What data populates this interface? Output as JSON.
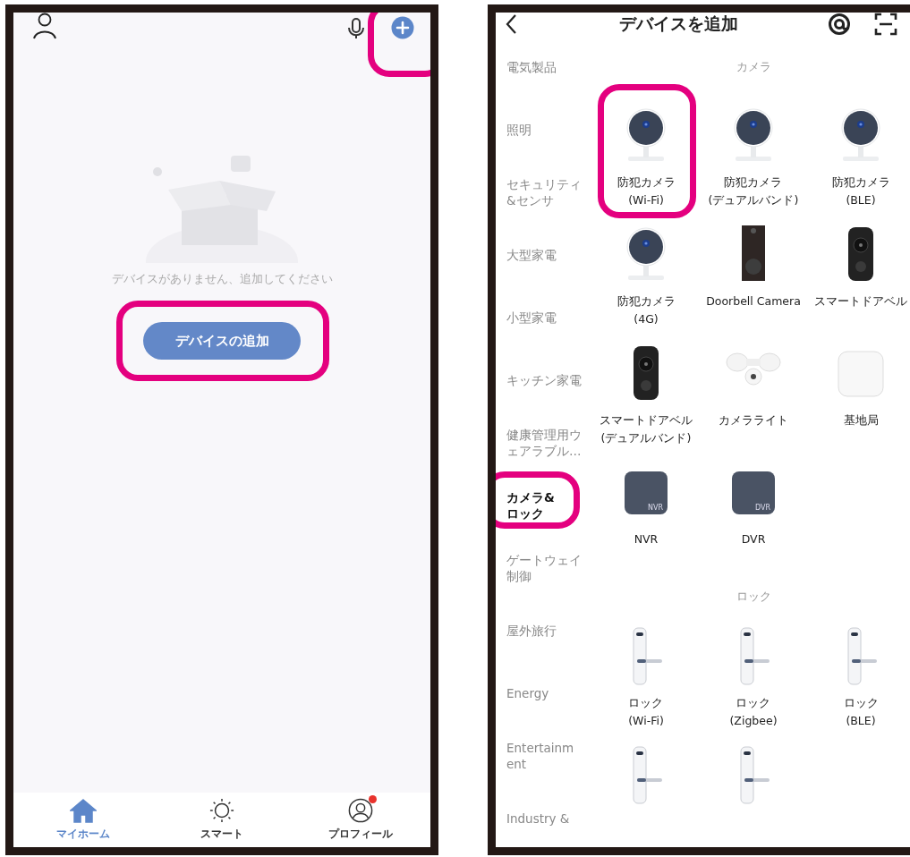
{
  "home": {
    "plus_highlighted": true,
    "empty_message": "デバイスがありません、追加してください",
    "add_button": {
      "label": "デバイスの追加",
      "highlighted": true
    },
    "tabs": [
      {
        "label": "マイホーム",
        "kind": "home",
        "selected": true,
        "notification": false
      },
      {
        "label": "スマート",
        "kind": "smart",
        "selected": false,
        "notification": false
      },
      {
        "label": "プロフィール",
        "kind": "profile",
        "selected": false,
        "notification": true
      }
    ]
  },
  "add_device": {
    "title": "デバイスを追加",
    "categories": [
      {
        "lines": [
          "電気製品"
        ],
        "selected": false
      },
      {
        "lines": [
          "照明"
        ],
        "selected": false
      },
      {
        "lines": [
          "セキュリティ",
          "&センサ"
        ],
        "selected": false
      },
      {
        "lines": [
          "大型家電"
        ],
        "selected": false
      },
      {
        "lines": [
          "小型家電"
        ],
        "selected": false
      },
      {
        "lines": [
          "キッチン家電"
        ],
        "selected": false
      },
      {
        "lines": [
          "健康管理用ウ",
          "ェアラブル…"
        ],
        "selected": false
      },
      {
        "lines": [
          "カメラ&",
          "ロック"
        ],
        "selected": true,
        "highlighted": true
      },
      {
        "lines": [
          "ゲートウェイ",
          "制御"
        ],
        "selected": false
      },
      {
        "lines": [
          "屋外旅行"
        ],
        "selected": false
      },
      {
        "lines": [
          "Energy"
        ],
        "selected": false
      },
      {
        "lines": [
          "Entertainm",
          "ent"
        ],
        "selected": false
      },
      {
        "lines": [
          "Industry &"
        ],
        "selected": false
      }
    ],
    "sections": [
      {
        "title": "カメラ",
        "items": [
          {
            "kind": "camera",
            "label": "防犯カメラ\n(Wi-Fi)",
            "highlighted": true
          },
          {
            "kind": "camera",
            "label": "防犯カメラ\n(デュアルバンド)"
          },
          {
            "kind": "camera",
            "label": "防犯カメラ\n(BLE)"
          },
          {
            "kind": "camera",
            "label": "防犯カメラ\n(4G)"
          },
          {
            "kind": "doorbell",
            "label": "Doorbell Camera"
          },
          {
            "kind": "smart-doorbell",
            "label": "スマートドアベル"
          },
          {
            "kind": "smart-doorbell",
            "label": "スマートドアベル\n(デュアルバンド)"
          },
          {
            "kind": "floodlight",
            "label": "カメラライト"
          },
          {
            "kind": "hub",
            "label": "基地局"
          },
          {
            "kind": "recorder",
            "tile_text": "NVR",
            "label": "NVR"
          },
          {
            "kind": "recorder",
            "tile_text": "DVR",
            "label": "DVR"
          }
        ]
      },
      {
        "title": "ロック",
        "items": [
          {
            "kind": "lock",
            "label": "ロック\n(Wi-Fi)"
          },
          {
            "kind": "lock",
            "label": "ロック\n(Zigbee)"
          },
          {
            "kind": "lock",
            "label": "ロック\n(BLE)"
          },
          {
            "kind": "lock"
          },
          {
            "kind": "lock"
          }
        ]
      }
    ]
  }
}
